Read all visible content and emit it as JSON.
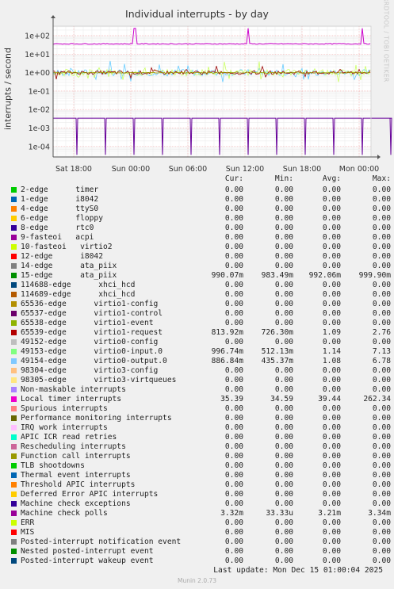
{
  "chart_data": {
    "type": "line",
    "title": "Individual interrupts - by day",
    "ylabel": "interrupts / second",
    "yscale": "log",
    "ylim": [
      3e-05,
      500
    ],
    "yticks": [
      "1e+02",
      "1e+01",
      "1e+00",
      "1e-01",
      "1e-02",
      "1e-03",
      "1e-04"
    ],
    "xticks": [
      "Sat 18:00",
      "Sun 00:00",
      "Sun 06:00",
      "Sun 12:00",
      "Sun 18:00",
      "Mon 00:00"
    ],
    "grid": true,
    "colors": {
      "local_timer": "#cc00cc",
      "mis_floor": "#660066",
      "ata_piix_15": "#999900",
      "virtio0_input": "#ccff66",
      "virtio0_output": "#66ccff",
      "virtio1_request": "#990000",
      "mcp": "#660099"
    },
    "series": [
      {
        "name": "Local timer interrupts",
        "cur": "35.39",
        "min": "34.59",
        "avg": "39.44",
        "max": "262.34"
      },
      {
        "name": "15-edge ata_piix",
        "cur": "990.07m",
        "min": "983.49m",
        "avg": "992.06m",
        "max": "999.90m"
      },
      {
        "name": "65539-edge virtio1-request",
        "cur": "813.92m",
        "min": "726.30m",
        "avg": "1.09",
        "max": "2.76"
      },
      {
        "name": "49153-edge virtio0-input.0",
        "cur": "996.74m",
        "min": "512.13m",
        "avg": "1.14",
        "max": "7.13"
      },
      {
        "name": "49154-edge virtio0-output.0",
        "cur": "886.84m",
        "min": "435.37m",
        "avg": "1.08",
        "max": "6.78"
      },
      {
        "name": "Machine check polls",
        "cur": "3.32m",
        "min": "33.33u",
        "avg": "3.21m",
        "max": "3.34m"
      }
    ]
  },
  "legend": {
    "headers": [
      "Cur:",
      "Min:",
      "Avg:",
      "Max:"
    ],
    "rows": [
      {
        "label": "2-edge      timer",
        "color": "#00cc00",
        "cur": "0.00",
        "min": "0.00",
        "avg": "0.00",
        "max": "0.00"
      },
      {
        "label": "1-edge      i8042",
        "color": "#0066b3",
        "cur": "0.00",
        "min": "0.00",
        "avg": "0.00",
        "max": "0.00"
      },
      {
        "label": "4-edge      ttyS0",
        "color": "#ff8000",
        "cur": "0.00",
        "min": "0.00",
        "avg": "0.00",
        "max": "0.00"
      },
      {
        "label": "6-edge      floppy",
        "color": "#ffcc00",
        "cur": "0.00",
        "min": "0.00",
        "avg": "0.00",
        "max": "0.00"
      },
      {
        "label": "8-edge      rtc0",
        "color": "#330099",
        "cur": "0.00",
        "min": "0.00",
        "avg": "0.00",
        "max": "0.00"
      },
      {
        "label": "9-fasteoi   acpi",
        "color": "#990099",
        "cur": "0.00",
        "min": "0.00",
        "avg": "0.00",
        "max": "0.00"
      },
      {
        "label": "10-fasteoi   virtio2",
        "color": "#ccff00",
        "cur": "0.00",
        "min": "0.00",
        "avg": "0.00",
        "max": "0.00"
      },
      {
        "label": "12-edge      i8042",
        "color": "#ff0000",
        "cur": "0.00",
        "min": "0.00",
        "avg": "0.00",
        "max": "0.00"
      },
      {
        "label": "14-edge      ata_piix",
        "color": "#808080",
        "cur": "0.00",
        "min": "0.00",
        "avg": "0.00",
        "max": "0.00"
      },
      {
        "label": "15-edge      ata_piix",
        "color": "#008f00",
        "cur": "990.07m",
        "min": "983.49m",
        "avg": "992.06m",
        "max": "999.90m"
      },
      {
        "label": "114688-edge      xhci_hcd",
        "color": "#00487d",
        "cur": "0.00",
        "min": "0.00",
        "avg": "0.00",
        "max": "0.00"
      },
      {
        "label": "114689-edge      xhci_hcd",
        "color": "#b35a00",
        "cur": "0.00",
        "min": "0.00",
        "avg": "0.00",
        "max": "0.00"
      },
      {
        "label": "65536-edge      virtio1-config",
        "color": "#b38f00",
        "cur": "0.00",
        "min": "0.00",
        "avg": "0.00",
        "max": "0.00"
      },
      {
        "label": "65537-edge      virtio1-control",
        "color": "#6b006b",
        "cur": "0.00",
        "min": "0.00",
        "avg": "0.00",
        "max": "0.00"
      },
      {
        "label": "65538-edge      virtio1-event",
        "color": "#8fb300",
        "cur": "0.00",
        "min": "0.00",
        "avg": "0.00",
        "max": "0.00"
      },
      {
        "label": "65539-edge      virtio1-request",
        "color": "#b30000",
        "cur": "813.92m",
        "min": "726.30m",
        "avg": "1.09",
        "max": "2.76"
      },
      {
        "label": "49152-edge      virtio0-config",
        "color": "#bebebe",
        "cur": "0.00",
        "min": "0.00",
        "avg": "0.00",
        "max": "0.00"
      },
      {
        "label": "49153-edge      virtio0-input.0",
        "color": "#80ff80",
        "cur": "996.74m",
        "min": "512.13m",
        "avg": "1.14",
        "max": "7.13"
      },
      {
        "label": "49154-edge      virtio0-output.0",
        "color": "#80c9ff",
        "cur": "886.84m",
        "min": "435.37m",
        "avg": "1.08",
        "max": "6.78"
      },
      {
        "label": "98304-edge      virtio3-config",
        "color": "#ffc080",
        "cur": "0.00",
        "min": "0.00",
        "avg": "0.00",
        "max": "0.00"
      },
      {
        "label": "98305-edge      virtio3-virtqueues",
        "color": "#ffe680",
        "cur": "0.00",
        "min": "0.00",
        "avg": "0.00",
        "max": "0.00"
      },
      {
        "label": "Non-maskable interrupts",
        "color": "#aa80ff",
        "cur": "0.00",
        "min": "0.00",
        "avg": "0.00",
        "max": "0.00"
      },
      {
        "label": "Local timer interrupts",
        "color": "#ee00cc",
        "cur": "35.39",
        "min": "34.59",
        "avg": "39.44",
        "max": "262.34"
      },
      {
        "label": "Spurious interrupts",
        "color": "#ff8080",
        "cur": "0.00",
        "min": "0.00",
        "avg": "0.00",
        "max": "0.00"
      },
      {
        "label": "Performance monitoring interrupts",
        "color": "#666600",
        "cur": "0.00",
        "min": "0.00",
        "avg": "0.00",
        "max": "0.00"
      },
      {
        "label": "IRQ work interrupts",
        "color": "#ffbfff",
        "cur": "0.00",
        "min": "0.00",
        "avg": "0.00",
        "max": "0.00"
      },
      {
        "label": "APIC ICR read retries",
        "color": "#00ffcc",
        "cur": "0.00",
        "min": "0.00",
        "avg": "0.00",
        "max": "0.00"
      },
      {
        "label": "Rescheduling interrupts",
        "color": "#cc6699",
        "cur": "0.00",
        "min": "0.00",
        "avg": "0.00",
        "max": "0.00"
      },
      {
        "label": "Function call interrupts",
        "color": "#999900",
        "cur": "0.00",
        "min": "0.00",
        "avg": "0.00",
        "max": "0.00"
      },
      {
        "label": "TLB shootdowns",
        "color": "#00cc00",
        "cur": "0.00",
        "min": "0.00",
        "avg": "0.00",
        "max": "0.00"
      },
      {
        "label": "Thermal event interrupts",
        "color": "#0066b3",
        "cur": "0.00",
        "min": "0.00",
        "avg": "0.00",
        "max": "0.00"
      },
      {
        "label": "Threshold APIC interrupts",
        "color": "#ff8000",
        "cur": "0.00",
        "min": "0.00",
        "avg": "0.00",
        "max": "0.00"
      },
      {
        "label": "Deferred Error APIC interrupts",
        "color": "#ffcc00",
        "cur": "0.00",
        "min": "0.00",
        "avg": "0.00",
        "max": "0.00"
      },
      {
        "label": "Machine check exceptions",
        "color": "#330099",
        "cur": "0.00",
        "min": "0.00",
        "avg": "0.00",
        "max": "0.00"
      },
      {
        "label": "Machine check polls",
        "color": "#990099",
        "cur": "3.32m",
        "min": "33.33u",
        "avg": "3.21m",
        "max": "3.34m"
      },
      {
        "label": "ERR",
        "color": "#ccff00",
        "cur": "0.00",
        "min": "0.00",
        "avg": "0.00",
        "max": "0.00"
      },
      {
        "label": "MIS",
        "color": "#ff0000",
        "cur": "0.00",
        "min": "0.00",
        "avg": "0.00",
        "max": "0.00"
      },
      {
        "label": "Posted-interrupt notification event",
        "color": "#808080",
        "cur": "0.00",
        "min": "0.00",
        "avg": "0.00",
        "max": "0.00"
      },
      {
        "label": "Nested posted-interrupt event",
        "color": "#008f00",
        "cur": "0.00",
        "min": "0.00",
        "avg": "0.00",
        "max": "0.00"
      },
      {
        "label": "Posted-interrupt wakeup event",
        "color": "#00487d",
        "cur": "0.00",
        "min": "0.00",
        "avg": "0.00",
        "max": "0.00"
      }
    ]
  },
  "footer": {
    "last_update": "Last update: Mon Dec 15 01:00:04 2025",
    "munin": "Munin 2.0.73",
    "watermark": "RRDTOOL / TOBI OETIKER"
  }
}
